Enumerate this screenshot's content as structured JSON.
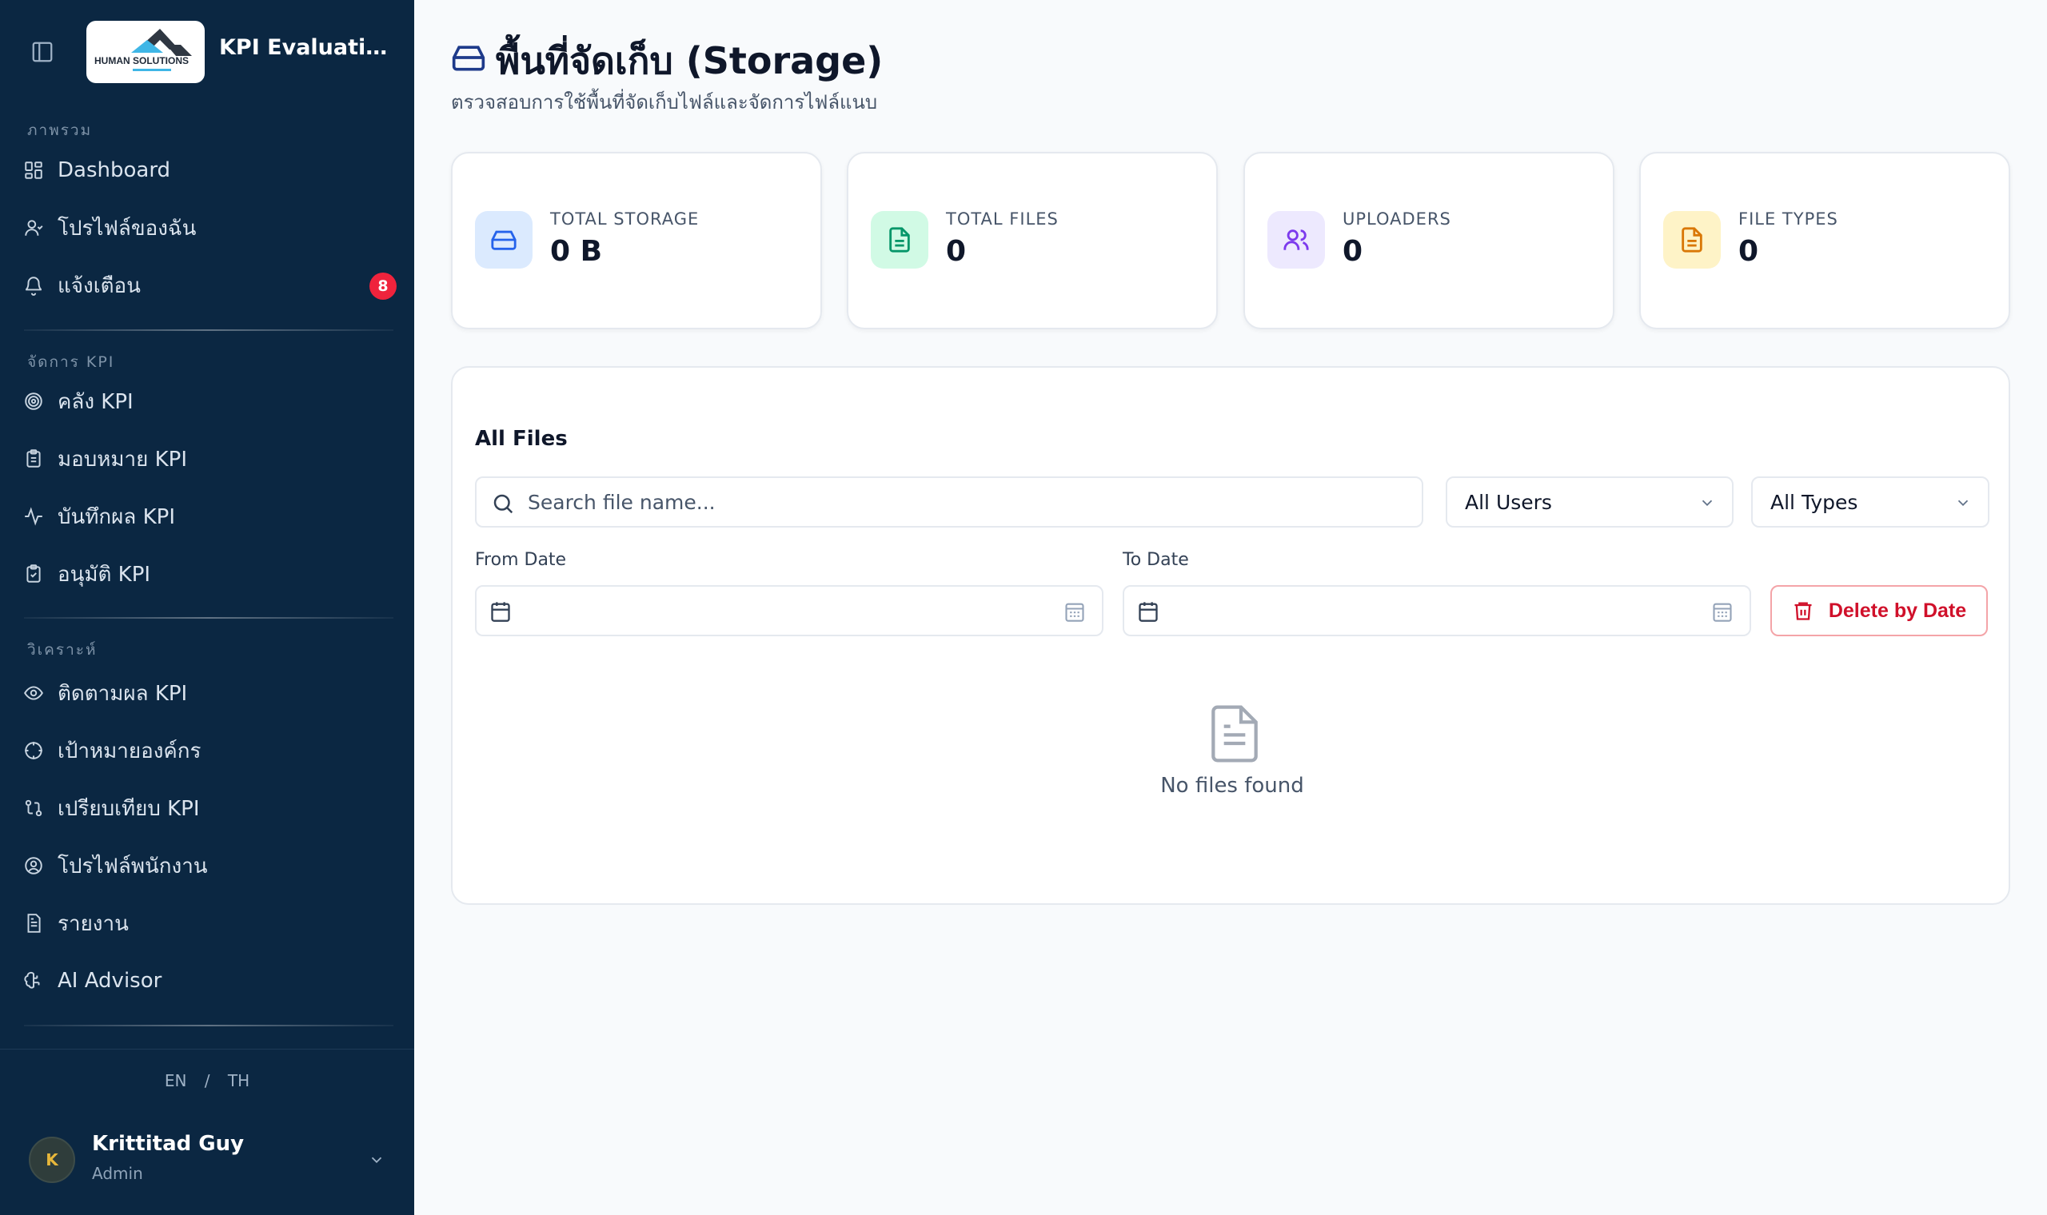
{
  "app": {
    "title": "KPI Evaluation ...",
    "logo_text": "HUMAN SOLUTIONS"
  },
  "sidebar": {
    "sections": [
      {
        "label": "ภาพรวม"
      },
      {
        "label": "จัดการ KPI"
      },
      {
        "label": "วิเคราะห์"
      }
    ],
    "items": [
      {
        "label": "Dashboard",
        "icon": "dashboard-grid-icon"
      },
      {
        "label": "โปรไฟล์ของฉัน",
        "icon": "user-icon"
      },
      {
        "label": "แจ้งเตือน",
        "icon": "bell-icon",
        "badge": "8"
      },
      {
        "label": "คลัง KPI",
        "icon": "target-icon"
      },
      {
        "label": "มอบหมาย KPI",
        "icon": "clipboard-list-icon"
      },
      {
        "label": "บันทึกผล KPI",
        "icon": "activity-icon"
      },
      {
        "label": "อนุมัติ KPI",
        "icon": "clipboard-check-icon"
      },
      {
        "label": "ติดตามผล KPI",
        "icon": "eye-icon"
      },
      {
        "label": "เป้าหมายองค์กร",
        "icon": "crosshair-icon"
      },
      {
        "label": "เปรียบเทียบ KPI",
        "icon": "compare-icon"
      },
      {
        "label": "โปรไฟล์พนักงาน",
        "icon": "user-circle-icon"
      },
      {
        "label": "รายงาน",
        "icon": "report-icon"
      },
      {
        "label": "AI Advisor",
        "icon": "brain-icon"
      }
    ],
    "lang": {
      "en": "EN",
      "sep": "/",
      "th": "TH"
    },
    "user": {
      "initial": "K",
      "name": "Krittitad Guy",
      "role": "Admin"
    }
  },
  "page": {
    "title": "พื้นที่จัดเก็บ (Storage)",
    "subtitle": "ตรวจสอบการใช้พื้นที่จัดเก็บไฟล์และจัดการไฟล์แนบ"
  },
  "stats": [
    {
      "label": "TOTAL STORAGE",
      "value": "0 B",
      "icon": "hard-drive-icon",
      "color": "#2563eb",
      "bg": "#dbeafe"
    },
    {
      "label": "TOTAL FILES",
      "value": "0",
      "icon": "file-text-icon",
      "color": "#059669",
      "bg": "#d1fae5"
    },
    {
      "label": "UPLOADERS",
      "value": "0",
      "icon": "users-icon",
      "color": "#7c3aed",
      "bg": "#ede9fe"
    },
    {
      "label": "FILE TYPES",
      "value": "0",
      "icon": "file-type-icon",
      "color": "#d97706",
      "bg": "#fef3c7"
    }
  ],
  "files": {
    "title": "All Files",
    "search_placeholder": "Search file name...",
    "users_select": "All Users",
    "types_select": "All Types",
    "from_label": "From Date",
    "to_label": "To Date",
    "delete_label": "Delete by Date",
    "empty_text": "No files found"
  }
}
